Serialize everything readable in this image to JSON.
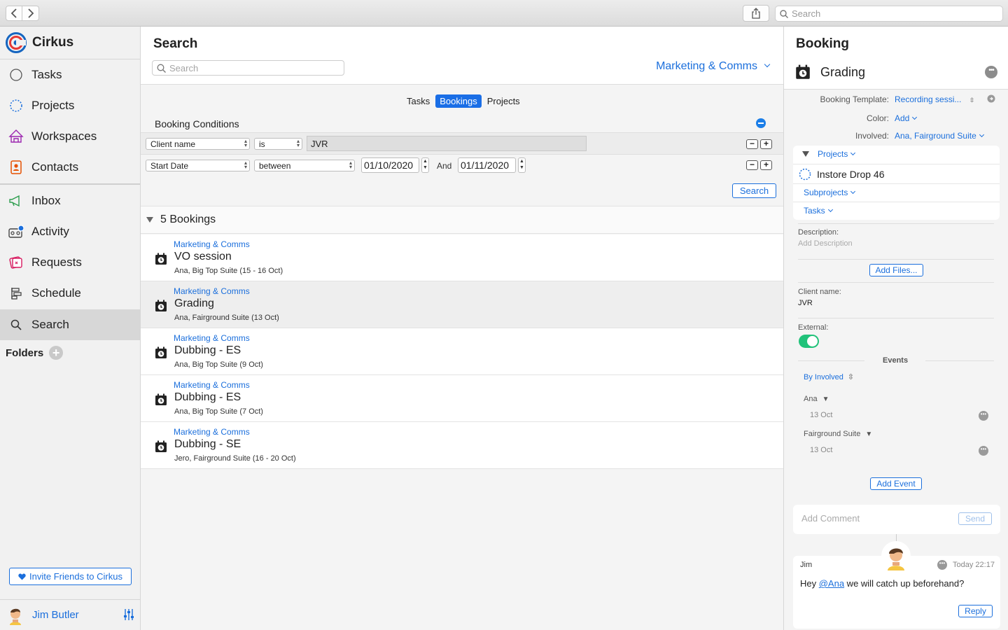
{
  "toolbar": {
    "search_placeholder": "Search"
  },
  "sidebar": {
    "app_name": "Cirkus",
    "items": [
      {
        "label": "Tasks"
      },
      {
        "label": "Projects"
      },
      {
        "label": "Workspaces"
      },
      {
        "label": "Contacts"
      },
      {
        "label": "Inbox"
      },
      {
        "label": "Activity"
      },
      {
        "label": "Requests"
      },
      {
        "label": "Schedule"
      },
      {
        "label": "Search"
      }
    ],
    "folders_label": "Folders",
    "invite_label": "Invite Friends to Cirkus",
    "user_name": "Jim Butler"
  },
  "search_panel": {
    "title": "Search",
    "search_placeholder": "Search",
    "workspace": "Marketing & Comms",
    "tabs": [
      {
        "label": "Tasks"
      },
      {
        "label": "Bookings"
      },
      {
        "label": "Projects"
      }
    ],
    "conditions_title": "Booking Conditions",
    "condition1": {
      "field": "Client name",
      "op": "is",
      "value": "JVR"
    },
    "condition2": {
      "field": "Start Date",
      "op": "between",
      "from": "01/10/2020",
      "and_label": "And",
      "to": "01/11/2020"
    },
    "search_button": "Search",
    "results_header": "5 Bookings",
    "results": [
      {
        "workspace": "Marketing & Comms",
        "title": "VO session",
        "subtitle": "Ana, Big Top Suite (15 - 16 Oct)"
      },
      {
        "workspace": "Marketing & Comms",
        "title": "Grading",
        "subtitle": "Ana, Fairground Suite (13 Oct)"
      },
      {
        "workspace": "Marketing & Comms",
        "title": "Dubbing - ES",
        "subtitle": "Ana, Big Top Suite (9 Oct)"
      },
      {
        "workspace": "Marketing & Comms",
        "title": "Dubbing - ES",
        "subtitle": "Ana, Big Top Suite (7 Oct)"
      },
      {
        "workspace": "Marketing & Comms",
        "title": "Dubbing - SE",
        "subtitle": "Jero, Fairground Suite (16 - 20 Oct)"
      }
    ]
  },
  "detail": {
    "title": "Booking",
    "name": "Grading",
    "template_label": "Booking Template:",
    "template_value": "Recording sessi...",
    "color_label": "Color:",
    "color_value": "Add",
    "involved_label": "Involved:",
    "involved_value": "Ana, Fairground Suite",
    "projects_label": "Projects",
    "project_name": "Instore Drop 46",
    "subprojects_label": "Subprojects",
    "tasks_label": "Tasks",
    "description_label": "Description:",
    "description_placeholder": "Add Description",
    "add_files": "Add Files...",
    "client_label": "Client name:",
    "client_value": "JVR",
    "external_label": "External:",
    "events_label": "Events",
    "by_involved": "By Involved",
    "event_groups": [
      {
        "name": "Ana",
        "date": "13 Oct"
      },
      {
        "name": "Fairground Suite",
        "date": "13 Oct"
      }
    ],
    "add_event": "Add Event",
    "comment_placeholder": "Add Comment",
    "send": "Send",
    "comment": {
      "author": "Jim",
      "time": "Today 22:17",
      "text_before": "Hey ",
      "mention": "@Ana",
      "text_after": " we will catch up beforehand?",
      "reply": "Reply"
    }
  },
  "colors": {
    "accent": "#1b6fdc",
    "toggle_on": "#21c27a",
    "selected_segment": "#1a6ee6"
  }
}
